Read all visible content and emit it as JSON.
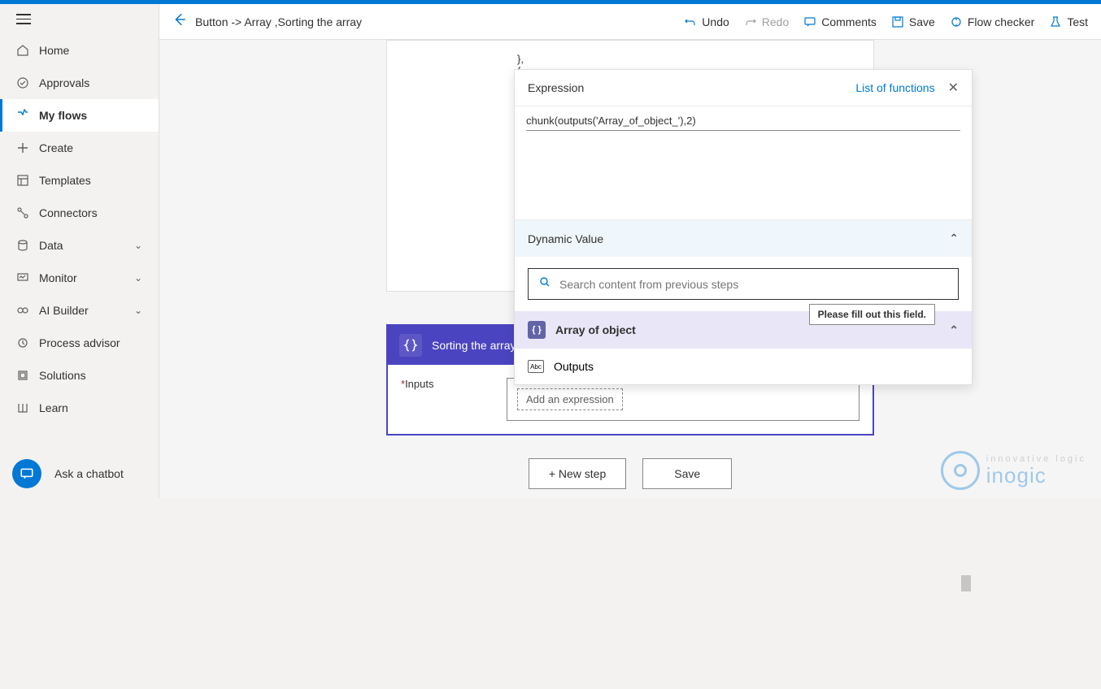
{
  "header": {
    "breadcrumb": "Button -> Array ,Sorting the array",
    "undo": "Undo",
    "redo": "Redo",
    "comments": "Comments",
    "save": "Save",
    "flow_checker": "Flow checker",
    "test": "Test"
  },
  "sidebar": {
    "home": "Home",
    "approvals": "Approvals",
    "my_flows": "My flows",
    "create": "Create",
    "templates": "Templates",
    "connectors": "Connectors",
    "data": "Data",
    "monitor": "Monitor",
    "ai_builder": "AI Builder",
    "process_advisor": "Process advisor",
    "solutions": "Solutions",
    "learn": "Learn",
    "ask_chatbot": "Ask a chatbot"
  },
  "canvas": {
    "code_snippet": "},\n{",
    "step_title": "Sorting the array",
    "inputs_label": "Inputs",
    "expression_chip": "Add an expression",
    "new_step": "+ New step",
    "save_btn": "Save"
  },
  "expression_panel": {
    "title": "Expression",
    "link": "List of functions",
    "formula": "chunk(outputs('Array_of_object_'),2)",
    "dynamic_value": "Dynamic Value",
    "search_placeholder": "Search content from previous steps",
    "section_title": "Array of object",
    "outputs_item": "Outputs",
    "tooltip": "Please fill out this field."
  },
  "watermark": {
    "sub": "innovative logic",
    "main": "inogic"
  }
}
